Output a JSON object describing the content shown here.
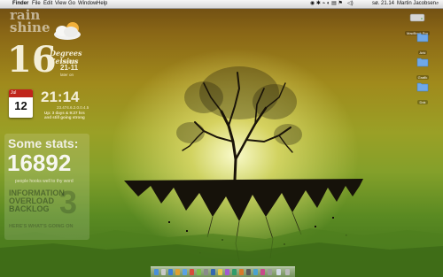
{
  "menubar": {
    "app": "Finder",
    "menus": [
      "File",
      "Edit",
      "View",
      "Go",
      "Window",
      "Help"
    ],
    "clock": "sø. 21.14",
    "user": "Martin Jacobsen"
  },
  "weather": {
    "line1": "rain",
    "line2": "shine",
    "temperature": "16",
    "unit_line1": "Degrees",
    "unit_line2": "Celsius",
    "tonight_label": "tonight be",
    "range": "21-11",
    "later_label": "later on"
  },
  "calendar": {
    "month": "Jul",
    "day": "12"
  },
  "clock_widget": {
    "time": "21:14",
    "small_line": "23.474.6.2.0.0.4.5",
    "uptime_line1": "Up: 3 days & 9:27 hrs",
    "uptime_line2": "and still going strong"
  },
  "stats": {
    "heading": "Some stats:",
    "count": "16892",
    "count_caption": "people hooks well to thy word",
    "info_line1": "INFORMATION",
    "info_line2": "OVERLOAD",
    "info_line3": "BACKLOG",
    "info_number": "3",
    "footer": "HERE'S WHAT'S GOING ON"
  },
  "desktop_icons": [
    {
      "label": "MacBook Pro",
      "icon": "hard-drive-icon"
    },
    {
      "label": "Arki",
      "icon": "folder-icon"
    },
    {
      "label": "Grafik",
      "icon": "folder-icon"
    },
    {
      "label": "Dok",
      "icon": "folder-icon"
    }
  ],
  "colors": {
    "calendar_red": "#c0251c",
    "folder_blue": "#6fa8e8",
    "text_cream": "#f4efd8"
  }
}
